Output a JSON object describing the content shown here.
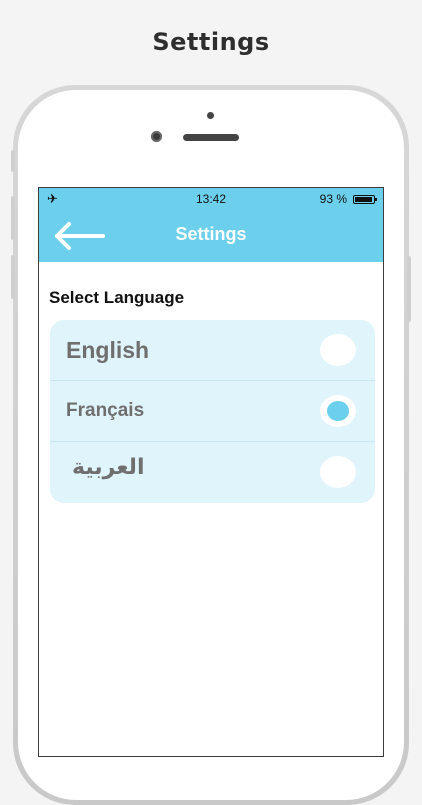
{
  "page": {
    "heading": "Settings"
  },
  "status_bar": {
    "airplane_icon": "airplane-icon",
    "time": "13:42",
    "battery_text": "93 %",
    "battery_level": 0.93
  },
  "nav": {
    "back_icon": "arrow-left-icon",
    "title": "Settings"
  },
  "settings": {
    "section_label": "Select Language",
    "languages": [
      {
        "label": "English",
        "selected": false
      },
      {
        "label": "Français",
        "selected": true
      },
      {
        "label": "العربية",
        "selected": false
      }
    ]
  },
  "colors": {
    "accent": "#6cd0ec",
    "card_background": "#e0f4fb",
    "label_text": "#6f6f6f"
  }
}
